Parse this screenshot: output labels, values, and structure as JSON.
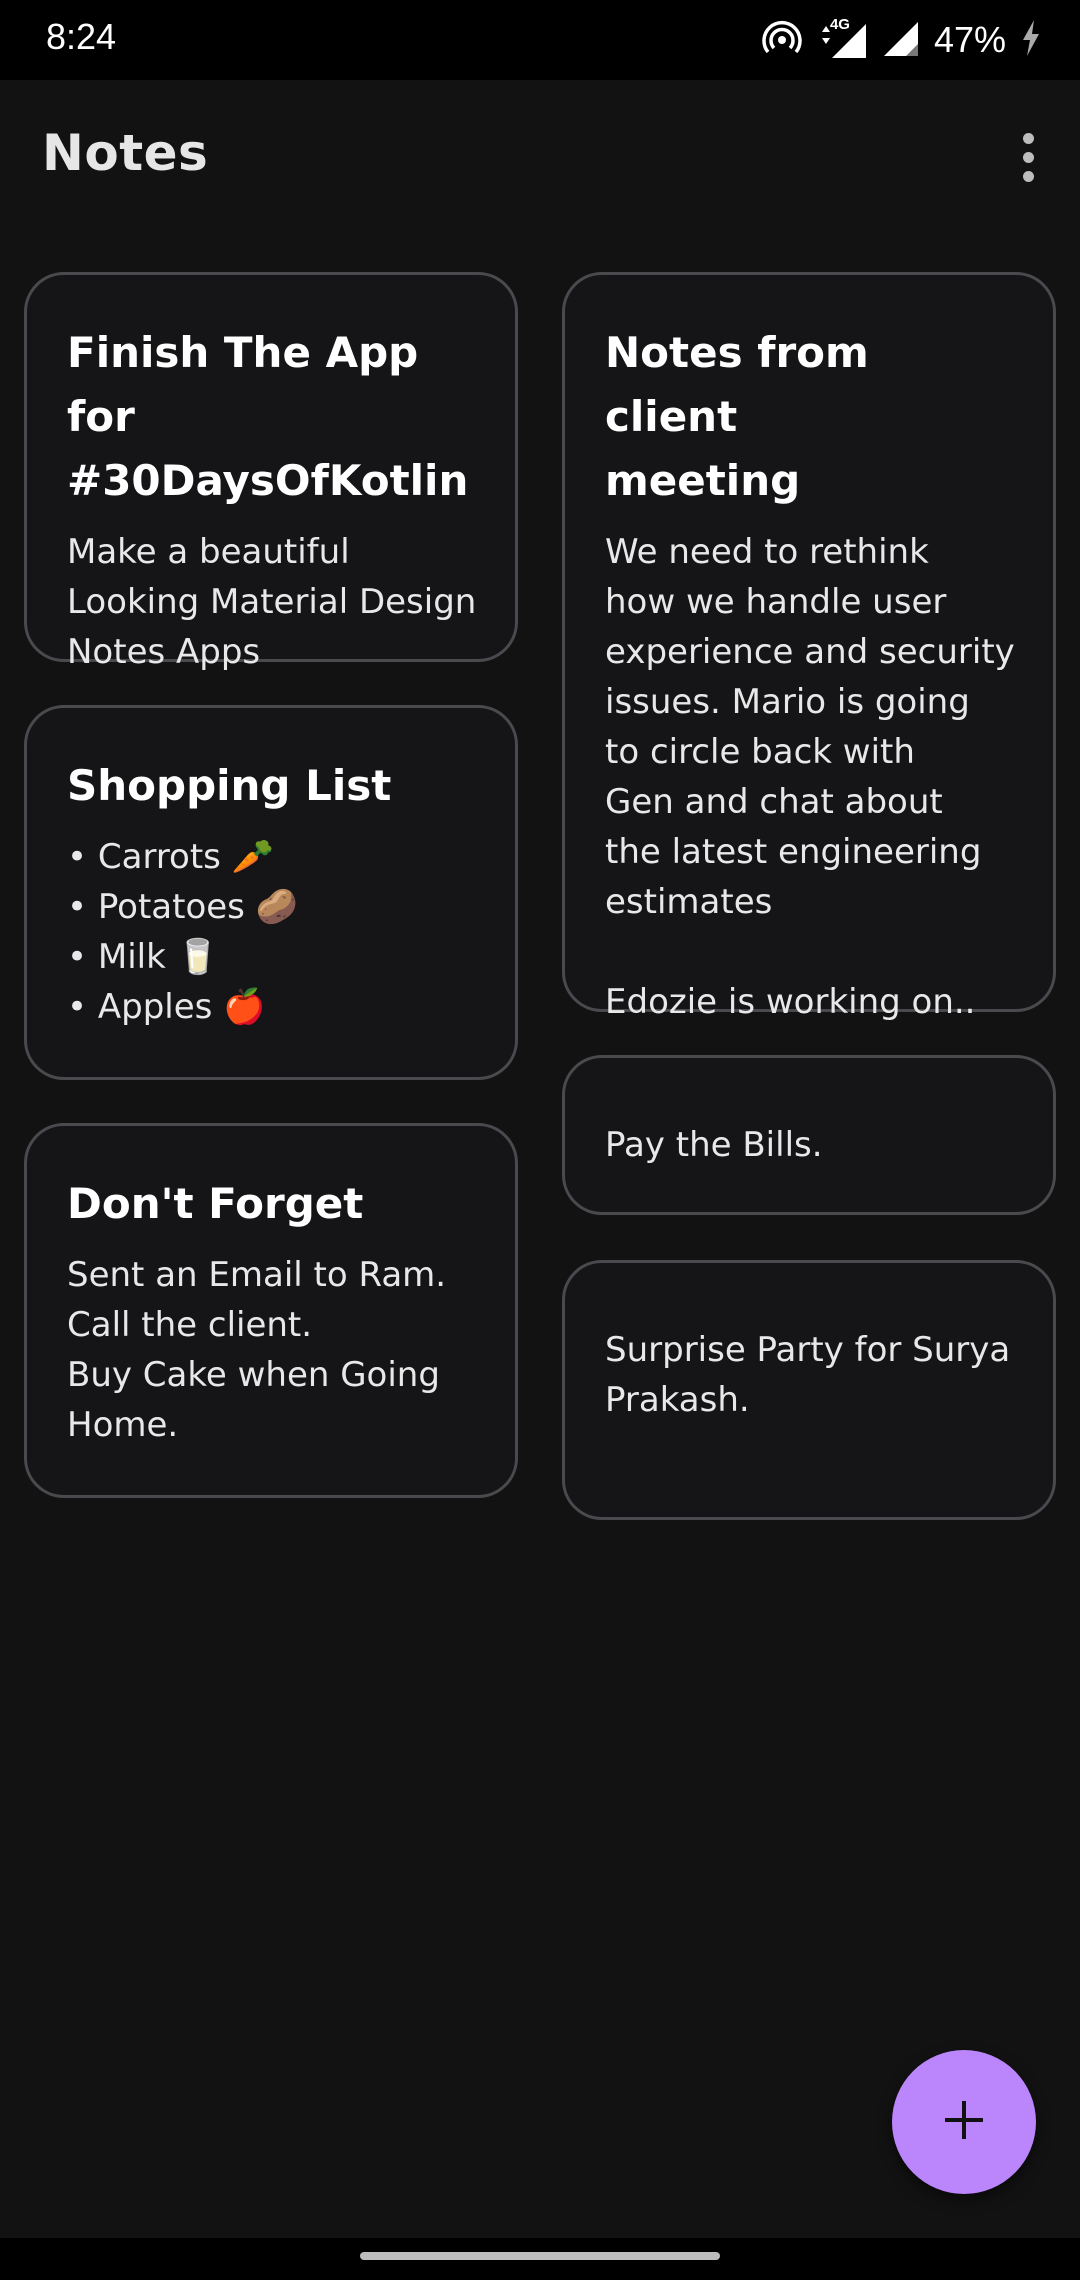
{
  "status_bar": {
    "time": "8:24",
    "network_label": "4G",
    "battery": "47%",
    "icons": [
      "hotspot-icon",
      "signal-4g-icon",
      "signal-icon",
      "charging-icon"
    ]
  },
  "app_bar": {
    "title": "Notes",
    "menu_icon": "more-vert-icon"
  },
  "notes": [
    {
      "title": "Finish The App for\n#30DaysOfKotlin",
      "body": "Make a beautiful\nLooking Material Design\nNotes Apps"
    },
    {
      "title": "Shopping List",
      "body": "• Carrots 🥕\n• Potatoes 🥔\n• Milk 🥛\n• Apples 🍎"
    },
    {
      "title": "Don't Forget",
      "body": "Sent an Email to Ram.\nCall the client.\nBuy Cake when Going\nHome."
    },
    {
      "title": "Notes from client\nmeeting",
      "body": "We need to rethink\nhow we handle user\nexperience and security\nissues. Mario is going\nto circle back with\nGen and chat about\nthe latest engineering\nestimates\n\nEdozie is working on.."
    },
    {
      "title": "",
      "body": "Pay the Bills."
    },
    {
      "title": "",
      "body": "Surprise Party for Surya\nPrakash."
    }
  ],
  "fab": {
    "icon": "plus-icon",
    "color": "#bb86fc"
  },
  "colors": {
    "background": "#121212",
    "card_border": "#4a4a4e",
    "accent": "#bb86fc"
  }
}
